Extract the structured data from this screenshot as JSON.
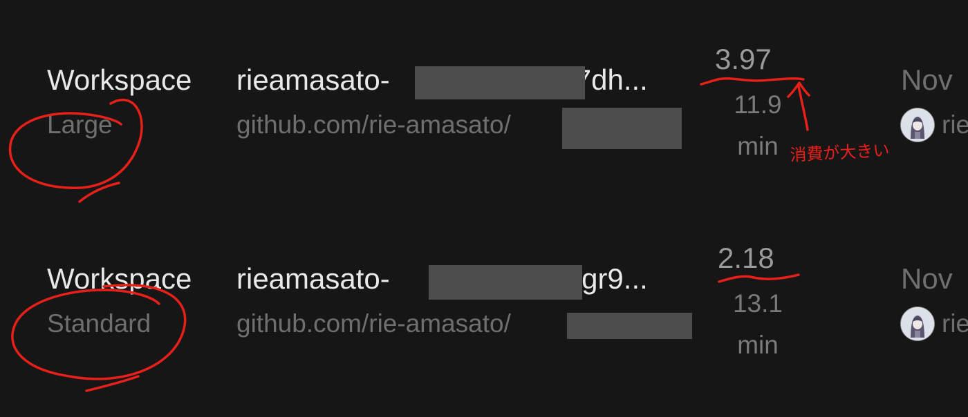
{
  "rows": [
    {
      "type": "Workspace",
      "size": "Large",
      "name_prefix": "rieamasato-",
      "name_suffix": "-7dh...",
      "repo_prefix": "github.com/rie-amasato/",
      "credits": "3.97",
      "minutes_value": "11.9",
      "minutes_unit": "min",
      "date": "Nov",
      "user": "rie"
    },
    {
      "type": "Workspace",
      "size": "Standard",
      "name_prefix": "rieamasato-",
      "name_suffix": "-lgr9...",
      "repo_prefix": "github.com/rie-amasato/",
      "credits": "2.18",
      "minutes_value": "13.1",
      "minutes_unit": "min",
      "date": "Nov",
      "user": "rie"
    }
  ],
  "annotation": {
    "note": "消費が大きい",
    "color": "#e8201a"
  }
}
